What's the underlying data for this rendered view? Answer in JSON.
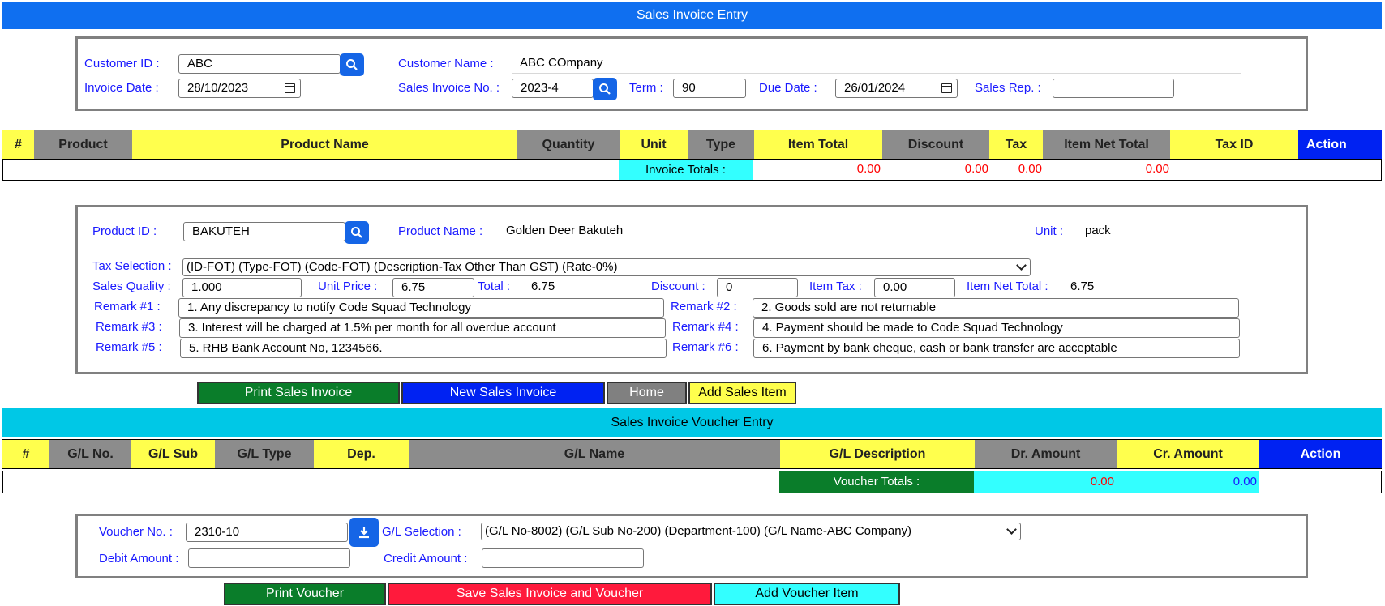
{
  "title_bar": "Sales Invoice Entry",
  "header": {
    "customer_id_label": "Customer ID :",
    "customer_id": "ABC",
    "customer_name_label": "Customer Name :",
    "customer_name": "ABC COmpany",
    "invoice_date_label": "Invoice Date :",
    "invoice_date": "28/10/2023",
    "sales_invoice_no_label": "Sales Invoice No. :",
    "sales_invoice_no": "2023-4",
    "term_label": "Term :",
    "term": "90",
    "due_date_label": "Due Date :",
    "due_date": "26/01/2024",
    "sales_rep_label": "Sales Rep. :",
    "sales_rep": ""
  },
  "item_table": {
    "columns": [
      "#",
      "Product",
      "Product Name",
      "Quantity",
      "Unit",
      "Type",
      "Item Total",
      "Discount",
      "Tax",
      "Item Net Total",
      "Tax ID",
      "Action"
    ],
    "totals_label": "Invoice Totals :",
    "item_total": "0.00",
    "discount": "0.00",
    "tax": "0.00",
    "item_net_total": "0.00"
  },
  "product": {
    "product_id_label": "Product ID :",
    "product_id": "BAKUTEH",
    "product_name_label": "Product Name :",
    "product_name": "Golden Deer Bakuteh",
    "unit_label": "Unit :",
    "unit": "pack",
    "tax_selection_label": "Tax Selection :",
    "tax_selection": "(ID-FOT) (Type-FOT) (Code-FOT) (Description-Tax Other Than GST) (Rate-0%)",
    "sales_quality_label": "Sales Quality :",
    "sales_quality": "1.000",
    "unit_price_label": "Unit Price :",
    "unit_price": "6.75",
    "total_label": "Total :",
    "total": "6.75",
    "discount_label": "Discount :",
    "discount": "0",
    "item_tax_label": "Item Tax :",
    "item_tax": "0.00",
    "item_net_total_label": "Item Net Total :",
    "item_net_total": "6.75"
  },
  "remarks": {
    "r1_label": "Remark #1 :",
    "r1": "1. Any discrepancy to notify Code Squad Technology",
    "r2_label": "Remark #2 :",
    "r2": "2. Goods sold are not returnable",
    "r3_label": "Remark #3 :",
    "r3": "3. Interest will be charged at 1.5% per month for all overdue account",
    "r4_label": "Remark #4 :",
    "r4": "4. Payment should be made to Code Squad Technology",
    "r5_label": "Remark #5 :",
    "r5": "5. RHB Bank Account No, 1234566.",
    "r6_label": "Remark #6 :",
    "r6": "6. Payment by bank cheque, cash or bank transfer are acceptable"
  },
  "buttons": {
    "print_sales_invoice": "Print Sales Invoice",
    "new_sales_invoice": "New Sales Invoice",
    "home": "Home",
    "add_sales_item": "Add Sales Item",
    "print_voucher": "Print Voucher",
    "save_invoice_voucher": "Save Sales Invoice and Voucher",
    "add_voucher_item": "Add Voucher Item"
  },
  "voucher_bar": "Sales Invoice Voucher Entry",
  "voucher_table": {
    "columns": [
      "#",
      "G/L No.",
      "G/L Sub",
      "G/L Type",
      "Dep.",
      "G/L Name",
      "G/L Description",
      "Dr. Amount",
      "Cr. Amount",
      "Action"
    ],
    "totals_label": "Voucher Totals :",
    "dr_total": "0.00",
    "cr_total": "0.00"
  },
  "voucher": {
    "voucher_no_label": "Voucher No. :",
    "voucher_no": "2310-10",
    "gl_selection_label": "G/L Selection :",
    "gl_selection": "(G/L No-8002) (G/L Sub No-200) (Department-100) (G/L Name-ABC Company)",
    "debit_amount_label": "Debit Amount :",
    "debit_amount": "",
    "credit_amount_label": "Credit Amount :",
    "credit_amount": ""
  },
  "colors": {
    "title_blue": "#0f6ff0",
    "voucher_cyan": "#00c8e6",
    "label_blue": "#1a1aff",
    "header_yellow": "#ffff4d",
    "header_gray": "#8c8c8c",
    "header_blue": "#0022f2"
  }
}
